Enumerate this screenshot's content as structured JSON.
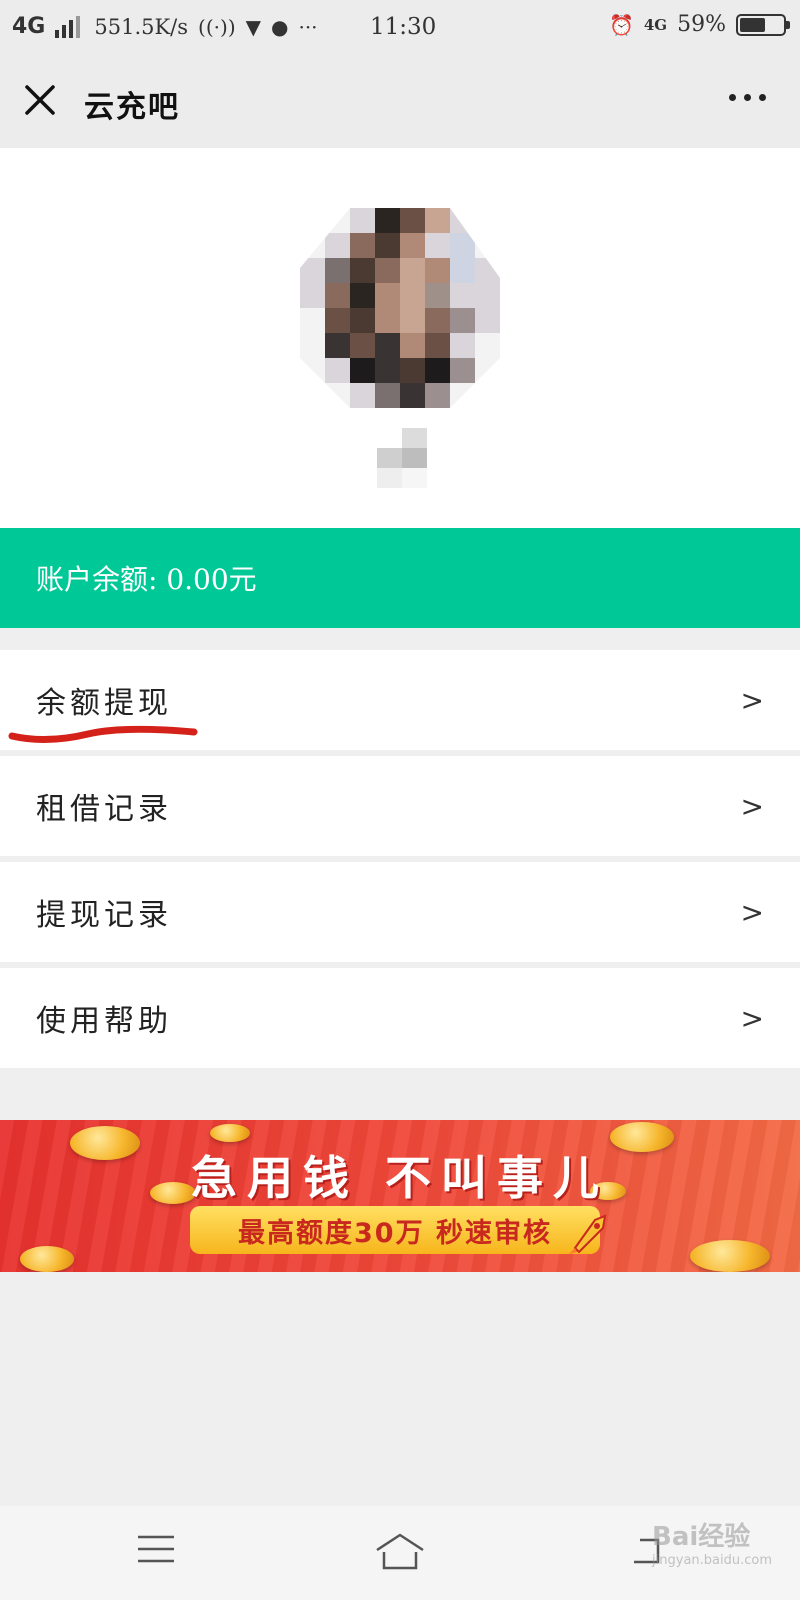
{
  "status_bar": {
    "network": "4G",
    "speed": "551.5K/s",
    "time": "11:30",
    "network_right": "4G",
    "battery": "59%",
    "battery_level": 0.59
  },
  "nav": {
    "title": "云充吧",
    "close_icon": "close-icon",
    "more_icon": "more-icon"
  },
  "balance": {
    "text": "账户余额: 0.00元"
  },
  "menu": {
    "items": [
      {
        "label": "余额提现",
        "arrow": ">"
      },
      {
        "label": "租借记录",
        "arrow": ">"
      },
      {
        "label": "提现记录",
        "arrow": ">"
      },
      {
        "label": "使用帮助",
        "arrow": ">"
      }
    ]
  },
  "banner": {
    "headline": "急用钱 不叫事儿",
    "subline": "最高额度30万 秒速审核"
  },
  "watermark": {
    "text": "Bai经验",
    "url": "jingyan.baidu.com"
  },
  "colors": {
    "accent": "#00c896",
    "banner_red": "#e8322f",
    "annotation_red": "#d4221a"
  }
}
